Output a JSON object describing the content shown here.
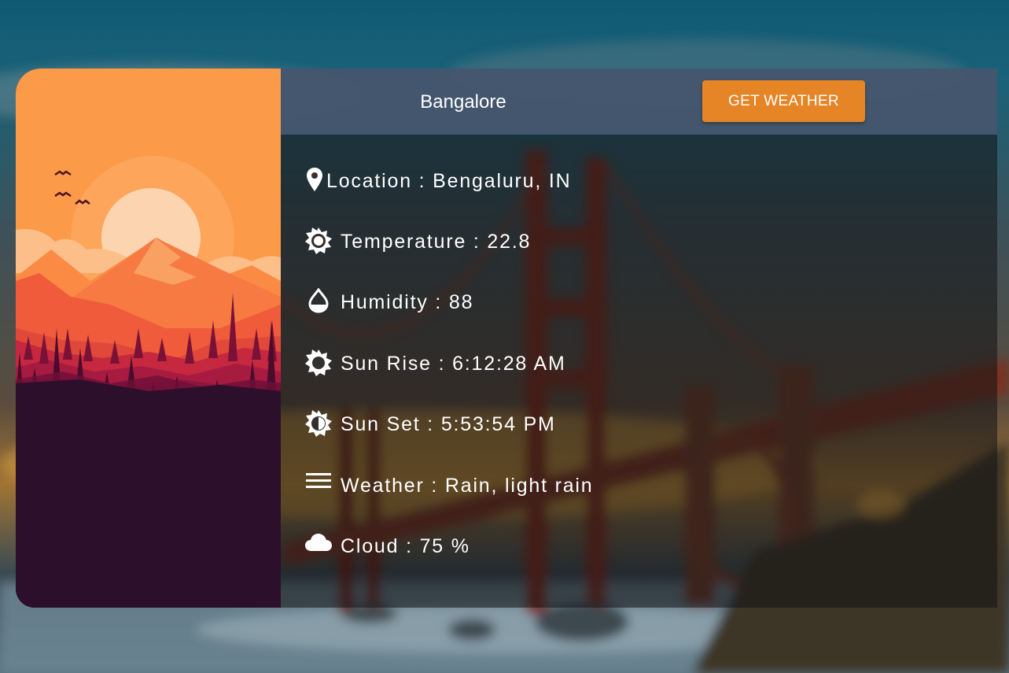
{
  "search": {
    "city_value": "Bangalore",
    "button_label": "GET WEATHER"
  },
  "weather": {
    "location": {
      "label": "Location",
      "separator": " : ",
      "value": "Bengaluru, IN",
      "icon": "map-pin-icon"
    },
    "temperature": {
      "label": "Temperature",
      "separator": " : ",
      "value": "22.8",
      "icon": "sun-icon"
    },
    "humidity": {
      "label": "Humidity",
      "separator": " : ",
      "value": "88",
      "icon": "water-drop-icon"
    },
    "sunrise": {
      "label": "Sun Rise",
      "separator": " : ",
      "value": "6:12:28 AM",
      "icon": "sunrise-icon"
    },
    "sunset": {
      "label": "Sun Set",
      "separator": " : ",
      "value": "5:53:54 PM",
      "icon": "sunset-icon"
    },
    "description": {
      "label": "Weather",
      "separator": " : ",
      "value": "Rain, light rain",
      "icon": "menu-lines-icon"
    },
    "cloud": {
      "label": "Cloud",
      "separator": " : ",
      "value": "75 %",
      "icon": "cloud-icon"
    }
  },
  "colors": {
    "button_orange": "#e58526",
    "search_bar": "#465870",
    "art_sky": "#fb9a48",
    "art_ground": "#2c0f2a"
  }
}
